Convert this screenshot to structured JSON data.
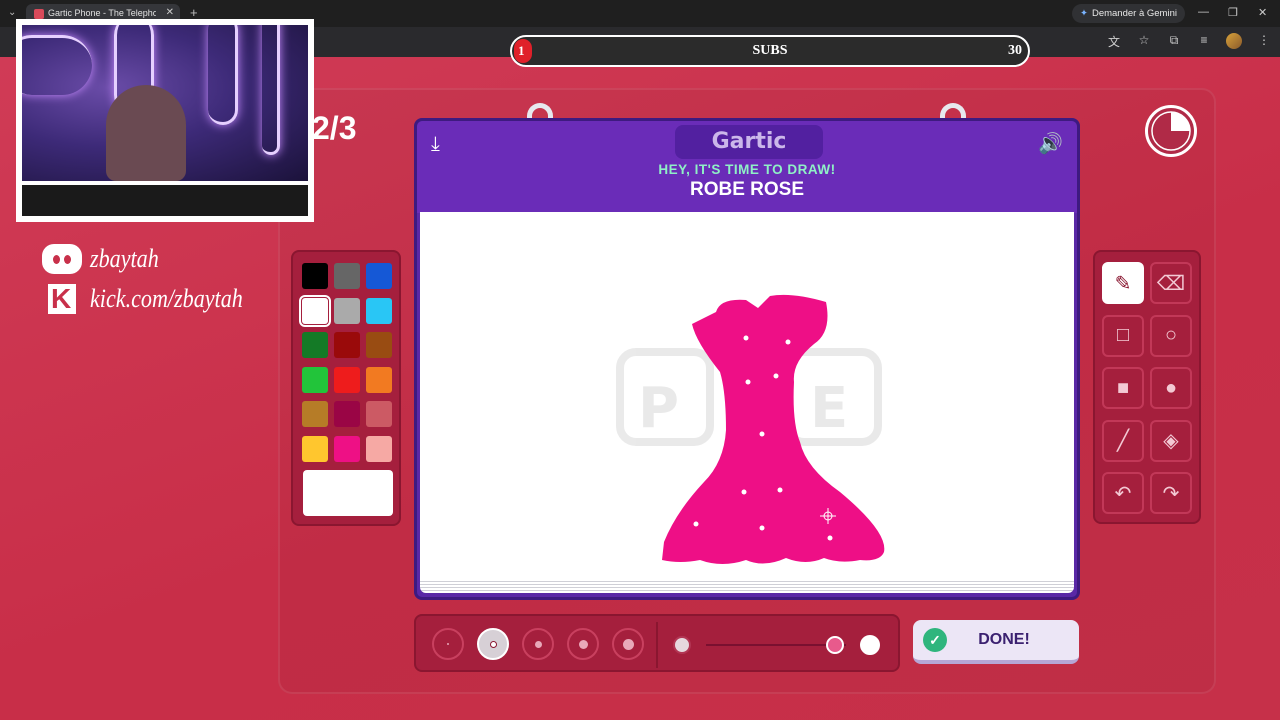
{
  "browser": {
    "tab_title": "Gartic Phone - The Telephone Game",
    "tab_close": "✕",
    "new_tab": "+",
    "gemini_label": "Demander à Gemini"
  },
  "subs_goal": {
    "current": "1",
    "label": "SUBS",
    "target": "30",
    "progress": 0.0333
  },
  "streamer": {
    "discord_handle": "zbaytah",
    "kick_url": "kick.com/zbaytah"
  },
  "game": {
    "round": "2/3",
    "logo": "Gartic",
    "prompt": "HEY, IT'S TIME TO DRAW!",
    "word": "ROBE ROSE",
    "done_label": "DONE!"
  },
  "palette": {
    "colors": [
      "#000000",
      "#666666",
      "#1558d6",
      "#ffffff",
      "#aaaaaa",
      "#29c6f5",
      "#147a26",
      "#9a0a0a",
      "#994c12",
      "#22c43a",
      "#ee1c1c",
      "#f27a21",
      "#b67c27",
      "#9a0545",
      "#cc5a64",
      "#ffc62e",
      "#ee1085",
      "#f6a9a4"
    ],
    "selected": "#ffffff",
    "current_color": "#ffffff"
  },
  "tools": [
    "pencil-icon",
    "eraser-icon",
    "rectangle-outline-icon",
    "ellipse-outline-icon",
    "rectangle-filled-icon",
    "ellipse-filled-icon",
    "line-icon",
    "fill-bucket-icon",
    "undo-icon",
    "redo-icon"
  ],
  "brush_sizes": {
    "count": 5,
    "selected_index": 1
  },
  "opacity": 0.92,
  "drawing": {
    "dress_color": "#ee0f86"
  }
}
